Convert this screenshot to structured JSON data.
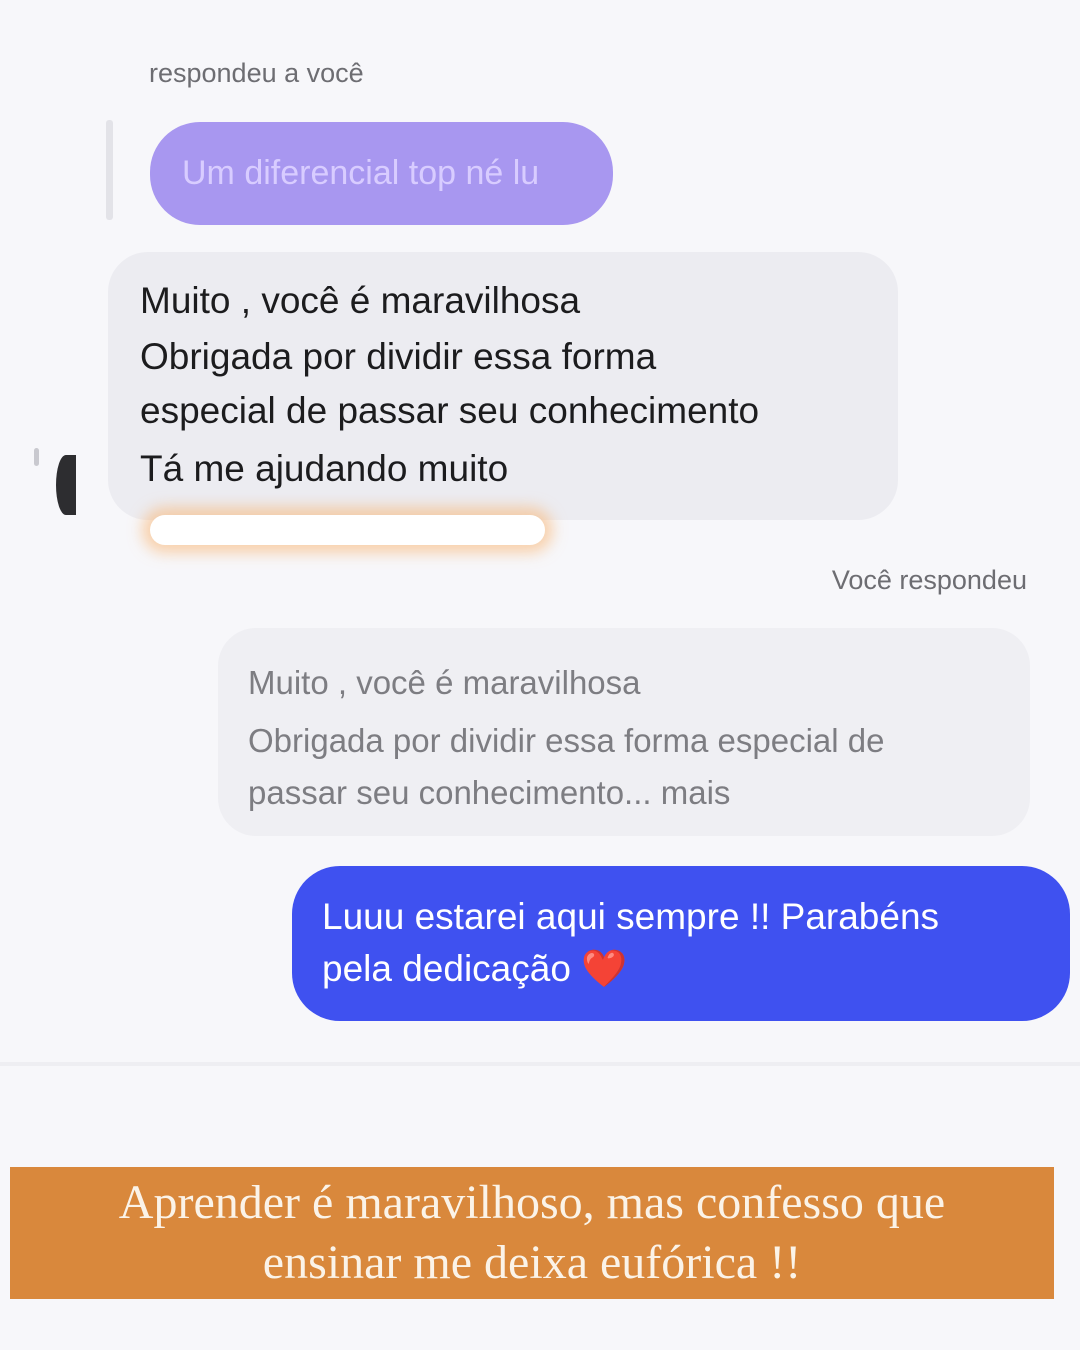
{
  "thread": {
    "reply_label_them": "respondeu a você",
    "quoted_message": "Um diferencial top né lu",
    "incoming_lines": [
      "Muito , você é maravilhosa",
      "Obrigada por dividir essa forma",
      "especial de passar seu conhecimento",
      "Tá me ajudando muito"
    ],
    "reply_label_you": "Você respondeu",
    "quoted_outgoing_lines": [
      "Muito , você é maravilhosa",
      "Obrigada por dividir essa forma especial de",
      "passar seu conhecimento... mais"
    ],
    "outgoing_lines": [
      "Luuu estarei aqui sempre !! Parabéns",
      "pela dedicação"
    ],
    "outgoing_emoji": "❤️",
    "colors": {
      "quoted_bubble": "#a897f0",
      "outgoing_bubble": "#3f51f0",
      "incoming_bubble": "#ececf1"
    }
  },
  "caption": {
    "line1": "Aprender é maravilhoso, mas confesso que",
    "line2": "ensinar me deixa eufórica !!",
    "background": "#d9883c"
  }
}
